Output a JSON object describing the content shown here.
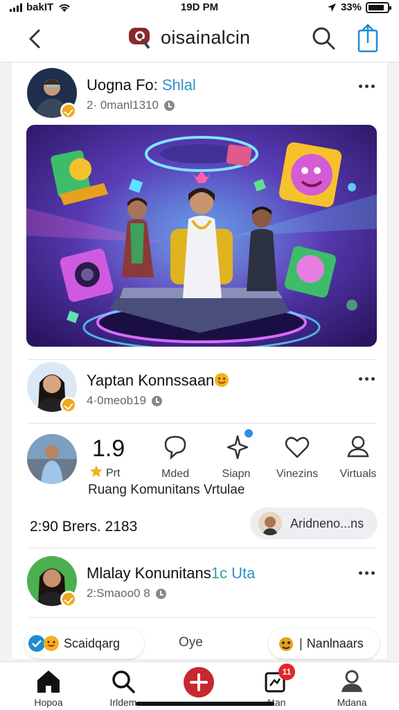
{
  "status_bar": {
    "carrier": "bakIT",
    "time": "19D PM",
    "battery": "33%",
    "battery_level": 0.85
  },
  "header": {
    "brand": "oisainalcin",
    "icons": [
      "back-arrow-icon",
      "brand-logo-icon",
      "search-icon",
      "share-icon"
    ]
  },
  "posts": [
    {
      "name": "Uogna Fo:",
      "name_accent": "Shlal",
      "meta": "2· 0manl1310"
    },
    {
      "name": "Yaptan Konnssaan",
      "meta": "4·0meob19"
    },
    {
      "name": "Mlalay Konunitans",
      "name_accent": "1c",
      "name_accent2": "Uta",
      "meta": "2:Smaoo0 8"
    }
  ],
  "stats": {
    "number": "1.9",
    "label": "Prt",
    "actions": [
      {
        "label": "Mded",
        "icon": "comment-icon"
      },
      {
        "label": "Siapn",
        "icon": "sparkle-icon"
      },
      {
        "label": "Vinezins",
        "icon": "heart-icon"
      },
      {
        "label": "Virtuals",
        "icon": "user-icon"
      }
    ],
    "community": "Ruang Komunitans Vrtulae"
  },
  "footer": {
    "time_text": "2:90 Brers. 2183",
    "pill_text": "Aridneno...ns"
  },
  "chips": {
    "left": "Scaidqarg",
    "middle": "Oye",
    "right": "Nanlnaars"
  },
  "bottom_nav": [
    {
      "label": "Hopoa",
      "icon": "home-icon"
    },
    {
      "label": "Irldem",
      "icon": "search-icon"
    },
    {
      "label": "",
      "icon": "add-icon"
    },
    {
      "label": "Atan",
      "icon": "notifications-icon",
      "badge": "11"
    },
    {
      "label": "Mdana",
      "icon": "profile-icon"
    }
  ],
  "colors": {
    "accent_blue": "#2e92c9",
    "badge_gold": "#f3a71c",
    "add_red": "#c8282d",
    "notify_red": "#e0272b"
  }
}
